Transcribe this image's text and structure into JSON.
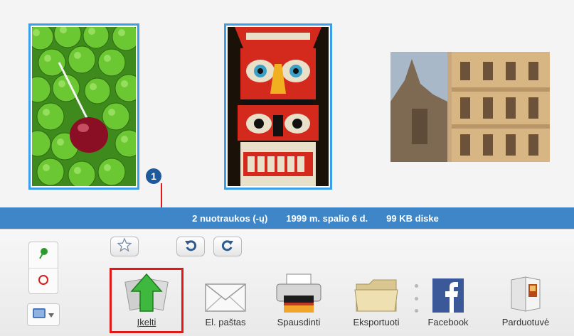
{
  "status_bar": {
    "count": "2 nuotraukos (-ų)",
    "date": "1999 m. spalio 6 d.",
    "size": "99 KB diske"
  },
  "callout": {
    "number": "1"
  },
  "photos": [
    {
      "name": "green-apples-photo",
      "selected": true
    },
    {
      "name": "totem-pole-photo",
      "selected": true
    },
    {
      "name": "church-building-photo",
      "selected": false
    }
  ],
  "tools": [
    {
      "id": "upload",
      "label": "Įkelti",
      "icon": "upload-arrow-icon"
    },
    {
      "id": "email",
      "label": "El. paštas",
      "icon": "envelope-icon"
    },
    {
      "id": "print",
      "label": "Spausdinti",
      "icon": "printer-icon"
    },
    {
      "id": "export",
      "label": "Eksportuoti",
      "icon": "folder-icon"
    },
    {
      "id": "facebook",
      "label": "Facebook",
      "icon": "facebook-icon"
    },
    {
      "id": "store",
      "label": "Parduotuvė",
      "icon": "store-card-icon"
    }
  ],
  "colors": {
    "selection": "#3a9ee8",
    "status_bar": "#3f86c8",
    "highlight": "#e01818"
  }
}
